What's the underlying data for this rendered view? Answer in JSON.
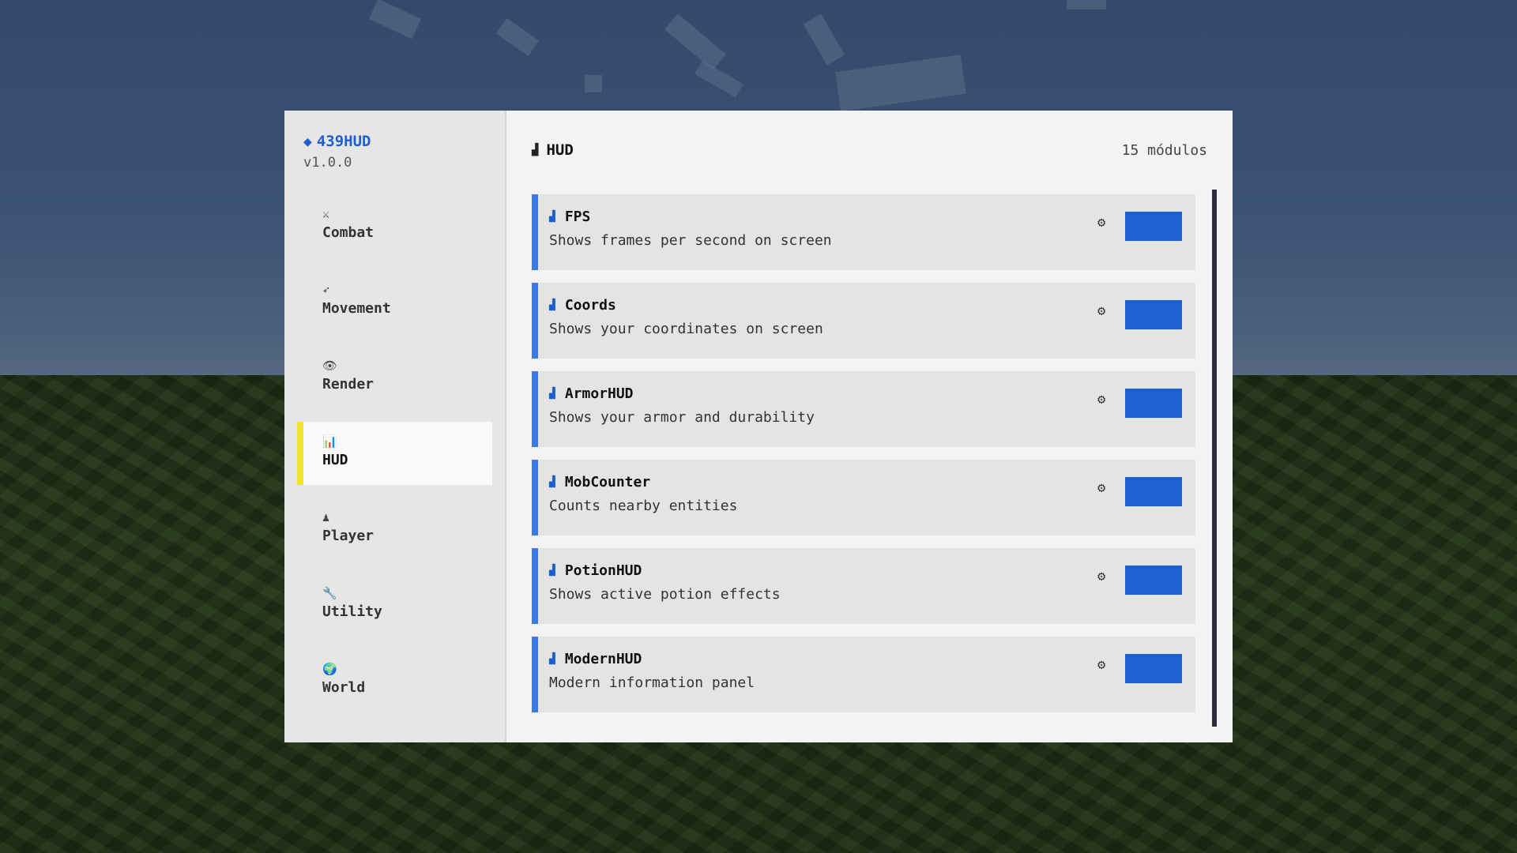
{
  "brand": {
    "name": "439HUD",
    "version": "v1.0.0"
  },
  "sidebar": {
    "items": [
      {
        "label": "Combat",
        "icon": "⚔"
      },
      {
        "label": "Movement",
        "icon": "➶"
      },
      {
        "label": "Render",
        "icon": "👁"
      },
      {
        "label": "HUD",
        "icon": "📊",
        "active": true
      },
      {
        "label": "Player",
        "icon": "♟"
      },
      {
        "label": "Utility",
        "icon": "🔧"
      },
      {
        "label": "World",
        "icon": "🌍"
      }
    ]
  },
  "main": {
    "title": "HUD",
    "count": "15 módulos",
    "modules": [
      {
        "name": "FPS",
        "desc": "Shows frames per second on screen"
      },
      {
        "name": "Coords",
        "desc": "Shows your coordinates on screen"
      },
      {
        "name": "ArmorHUD",
        "desc": "Shows your armor and durability"
      },
      {
        "name": "MobCounter",
        "desc": "Counts nearby entities"
      },
      {
        "name": "PotionHUD",
        "desc": "Shows active potion effects"
      },
      {
        "name": "ModernHUD",
        "desc": "Modern information panel"
      }
    ]
  },
  "colors": {
    "accent": "#1f5fd0",
    "module_bar": "#3a78e0",
    "active_indicator": "#f2e430",
    "panel_bg": "#f3f3f3",
    "sidebar_bg": "#e6e6e6"
  },
  "icons": {
    "brand": "diamond-icon",
    "module": "chart-icon",
    "settings": "gear-icon"
  }
}
